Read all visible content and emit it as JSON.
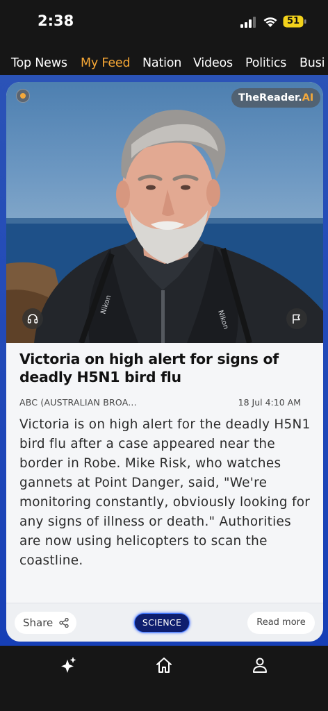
{
  "status_bar": {
    "time": "2:38",
    "battery": "51"
  },
  "tabs": [
    {
      "label": "Top News",
      "active": false
    },
    {
      "label": "My Feed",
      "active": true
    },
    {
      "label": "Nation",
      "active": false
    },
    {
      "label": "Videos",
      "active": false
    },
    {
      "label": "Politics",
      "active": false
    },
    {
      "label": "Busi",
      "active": false
    }
  ],
  "colors": {
    "accent": "#f6a735",
    "backdrop": "#1f47b8",
    "tag_bg": "#0e1e6e"
  },
  "card": {
    "brand": {
      "name": "TheReader.",
      "suffix": "AI"
    },
    "headline": "Victoria on high alert for signs of deadly H5N1 bird flu",
    "source": "ABC (AUSTRALIAN BROA...",
    "date": "18 Jul 4:10 AM",
    "body": "Victoria is on high alert for the deadly H5N1 bird flu after a case appeared near the border in Robe. Mike Risk, who watches gannets at Point Danger, said, \"We're monitoring constantly, obviously looking for any signs of illness or death.\" Authorities are now using helicopters to scan the coastline.",
    "share_label": "Share",
    "tag": "SCIENCE",
    "read_more": "Read more",
    "camera_strap_text": "Nikon"
  },
  "bottom_nav": [
    {
      "icon": "sparkle-icon"
    },
    {
      "icon": "home-icon"
    },
    {
      "icon": "profile-icon"
    }
  ]
}
